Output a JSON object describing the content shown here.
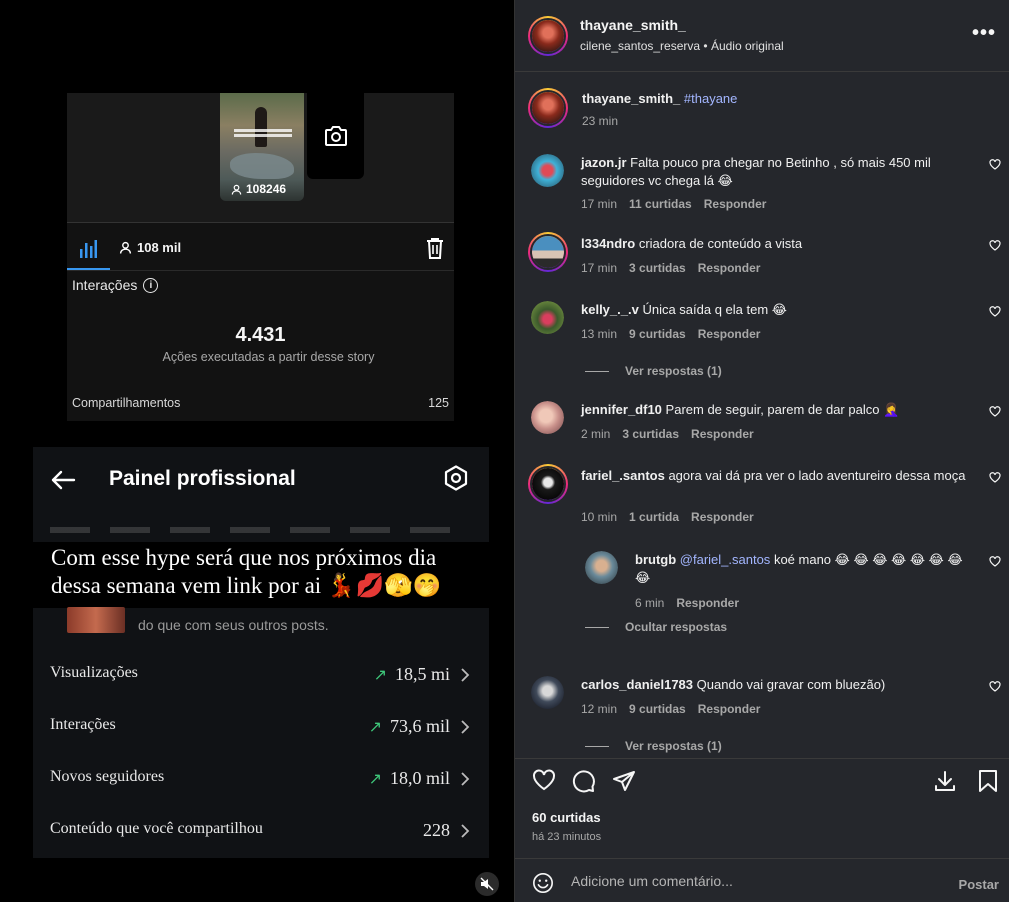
{
  "media": {
    "story_card": {
      "thumb_views": "108246",
      "reach": "108 mil",
      "interactions_label": "Interações",
      "interactions_value": "4.431",
      "interactions_caption": "Ações executadas a partir desse story",
      "shares_label": "Compartilhamentos",
      "shares_value": "125"
    },
    "painel": {
      "title": "Painel profissional",
      "overlay_caption": "Com esse hype será que nos próximos dia dessa semana vem link por ai 💃💋🫣🤭",
      "behind_text": "do que com seus outros posts.",
      "metrics": [
        {
          "label": "Visualizações",
          "value": "18,5 mi",
          "trend": "↗"
        },
        {
          "label": "Interações",
          "value": "73,6 mil",
          "trend": "↗"
        },
        {
          "label": "Novos seguidores",
          "value": "18,0 mil",
          "trend": "↗"
        },
        {
          "label": "Conteúdo que você compartilhou",
          "value": "228",
          "trend": ""
        }
      ]
    }
  },
  "post": {
    "author": "thayane_smith_",
    "subtitle": "cilene_santos_reserva • Áudio original",
    "more_label": "•••",
    "caption": {
      "user": "thayane_smith_",
      "hashtag": "#thayane",
      "time": "23 min"
    },
    "comments": [
      {
        "user": "jazon.jr",
        "text": "Falta pouco pra chegar no Betinho , só mais 450 mil seguidores vc chega lá 😂",
        "time": "17 min",
        "likes": "11 curtidas",
        "reply": "Responder"
      },
      {
        "user": "l334ndro",
        "text": "criadora de conteúdo a vista",
        "time": "17 min",
        "likes": "3 curtidas",
        "reply": "Responder"
      },
      {
        "user": "kelly_._.v",
        "text": "Única saída q ela tem 😂",
        "time": "13 min",
        "likes": "9 curtidas",
        "reply": "Responder",
        "toggle": "Ver respostas (1)"
      },
      {
        "user": "jennifer_df10",
        "text": "Parem de seguir, parem de dar palco 🤦‍♀️",
        "time": "2 min",
        "likes": "3 curtidas",
        "reply": "Responder"
      },
      {
        "user": "fariel_.santos",
        "text": "agora vai dá pra ver o lado aventureiro dessa moça",
        "time": "10 min",
        "likes": "1 curtida",
        "reply": "Responder"
      },
      {
        "user": "brutgb",
        "mention": "@fariel_.santos",
        "text": "koé mano 😂 😂 😂 😂 😂 😂 😂 😂",
        "time": "6 min",
        "reply": "Responder",
        "toggle": "Ocultar respostas"
      },
      {
        "user": "carlos_daniel1783",
        "text": "Quando vai gravar com bluezão)",
        "time": "12 min",
        "likes": "9 curtidas",
        "reply": "Responder",
        "toggle": "Ver respostas (1)"
      }
    ],
    "likes_count": "60 curtidas",
    "posted_ago": "há 23 minutos",
    "compose": {
      "placeholder": "Adicione um comentário...",
      "post_label": "Postar"
    }
  }
}
